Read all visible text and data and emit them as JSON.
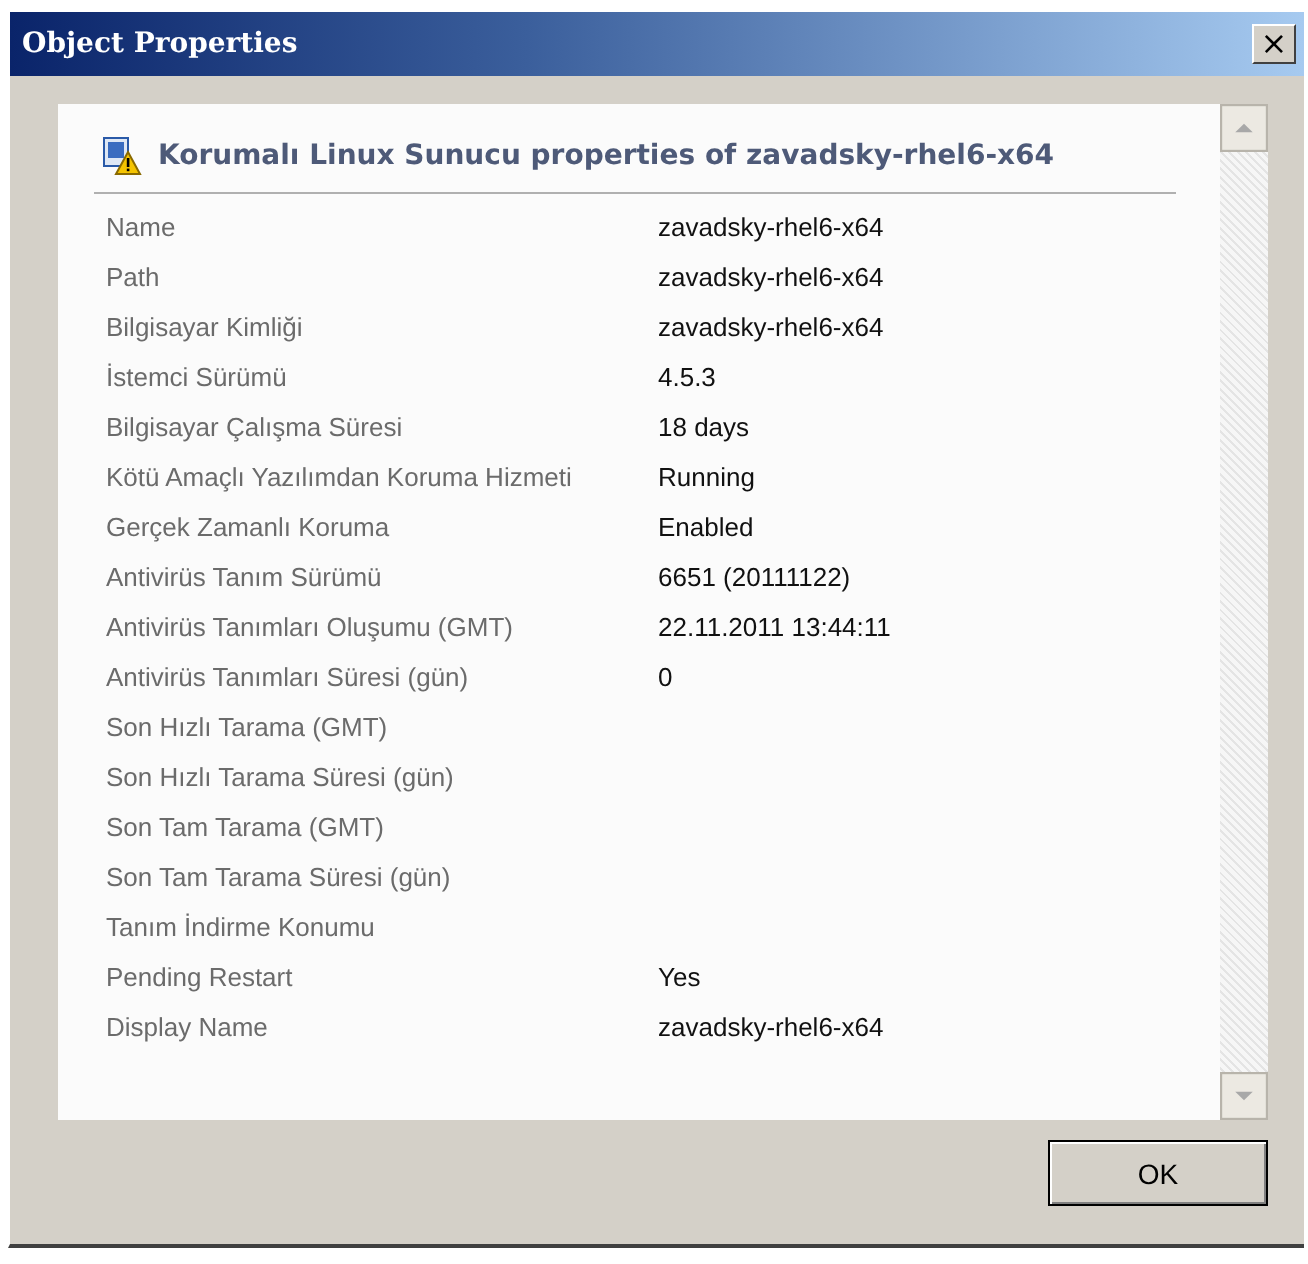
{
  "window": {
    "title": "Object Properties",
    "close": "×"
  },
  "header": "Korumalı Linux Sunucu properties of zavadsky-rhel6-x64",
  "properties": [
    {
      "label": "Name",
      "value": "zavadsky-rhel6-x64"
    },
    {
      "label": "Path",
      "value": "zavadsky-rhel6-x64"
    },
    {
      "label": "Bilgisayar Kimliği",
      "value": "zavadsky-rhel6-x64"
    },
    {
      "label": "İstemci Sürümü",
      "value": "4.5.3"
    },
    {
      "label": "Bilgisayar Çalışma Süresi",
      "value": "18 days"
    },
    {
      "label": "Kötü Amaçlı Yazılımdan Koruma Hizmeti",
      "value": "Running"
    },
    {
      "label": "Gerçek Zamanlı Koruma",
      "value": "Enabled"
    },
    {
      "label": "Antivirüs Tanım Sürümü",
      "value": "6651 (20111122)"
    },
    {
      "label": "Antivirüs Tanımları Oluşumu (GMT)",
      "value": "22.11.2011 13:44:11"
    },
    {
      "label": "Antivirüs Tanımları Süresi (gün)",
      "value": "0"
    },
    {
      "label": "Son Hızlı Tarama (GMT)"
    },
    {
      "label": "Son Hızlı Tarama Süresi (gün)"
    },
    {
      "label": "Son Tam Tarama (GMT)"
    },
    {
      "label": "Son Tam Tarama Süresi (gün)"
    },
    {
      "label": "Tanım İndirme Konumu"
    },
    {
      "label": "Pending Restart",
      "value": "Yes"
    },
    {
      "label": "Display Name",
      "value": "zavadsky-rhel6-x64"
    }
  ],
  "buttons": [
    "OK"
  ]
}
